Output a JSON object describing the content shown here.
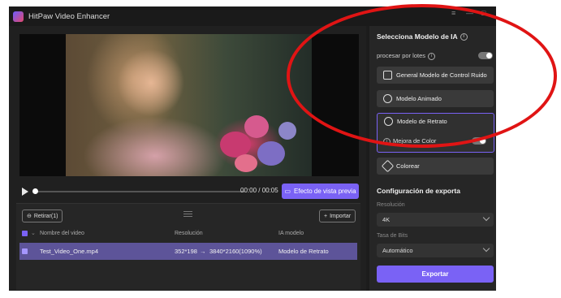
{
  "app": {
    "title": "HitPaw Video Enhancer"
  },
  "window_controls": [
    "≡",
    "—",
    "□"
  ],
  "player": {
    "time": "00:00 / 00:05",
    "preview_button": "Efecto de vista previa"
  },
  "list": {
    "remove_button": "Retirar(1)",
    "import_button": "Importar",
    "columns": [
      "Nombre del video",
      "Resolución",
      "IA modelo"
    ],
    "rows": [
      {
        "name": "Test_Video_One.mp4",
        "res_from": "352*198",
        "arrow": "→",
        "res_to": "3840*2160(1090%)",
        "model": "Modelo de Retrato"
      }
    ]
  },
  "panel": {
    "title": "Selecciona Modelo de IA",
    "batch_label": "procesar por lotes",
    "models": {
      "general": "General Modelo de Control Ruido",
      "animated": "Modelo Animado",
      "portrait": "Modelo de Retrato",
      "color_enhance": "Mejora de Color",
      "colorize": "Colorear"
    },
    "export_title": "Configuración de exporta",
    "resolution_label": "Resolución",
    "resolution_value": "4K",
    "bitrate_label": "Tasa de Bits",
    "bitrate_value": "Automático",
    "export_button": "Exportar"
  },
  "colors": {
    "accent": "#7a62f5",
    "annotation": "#e01414",
    "background": "#1c1c1c"
  }
}
